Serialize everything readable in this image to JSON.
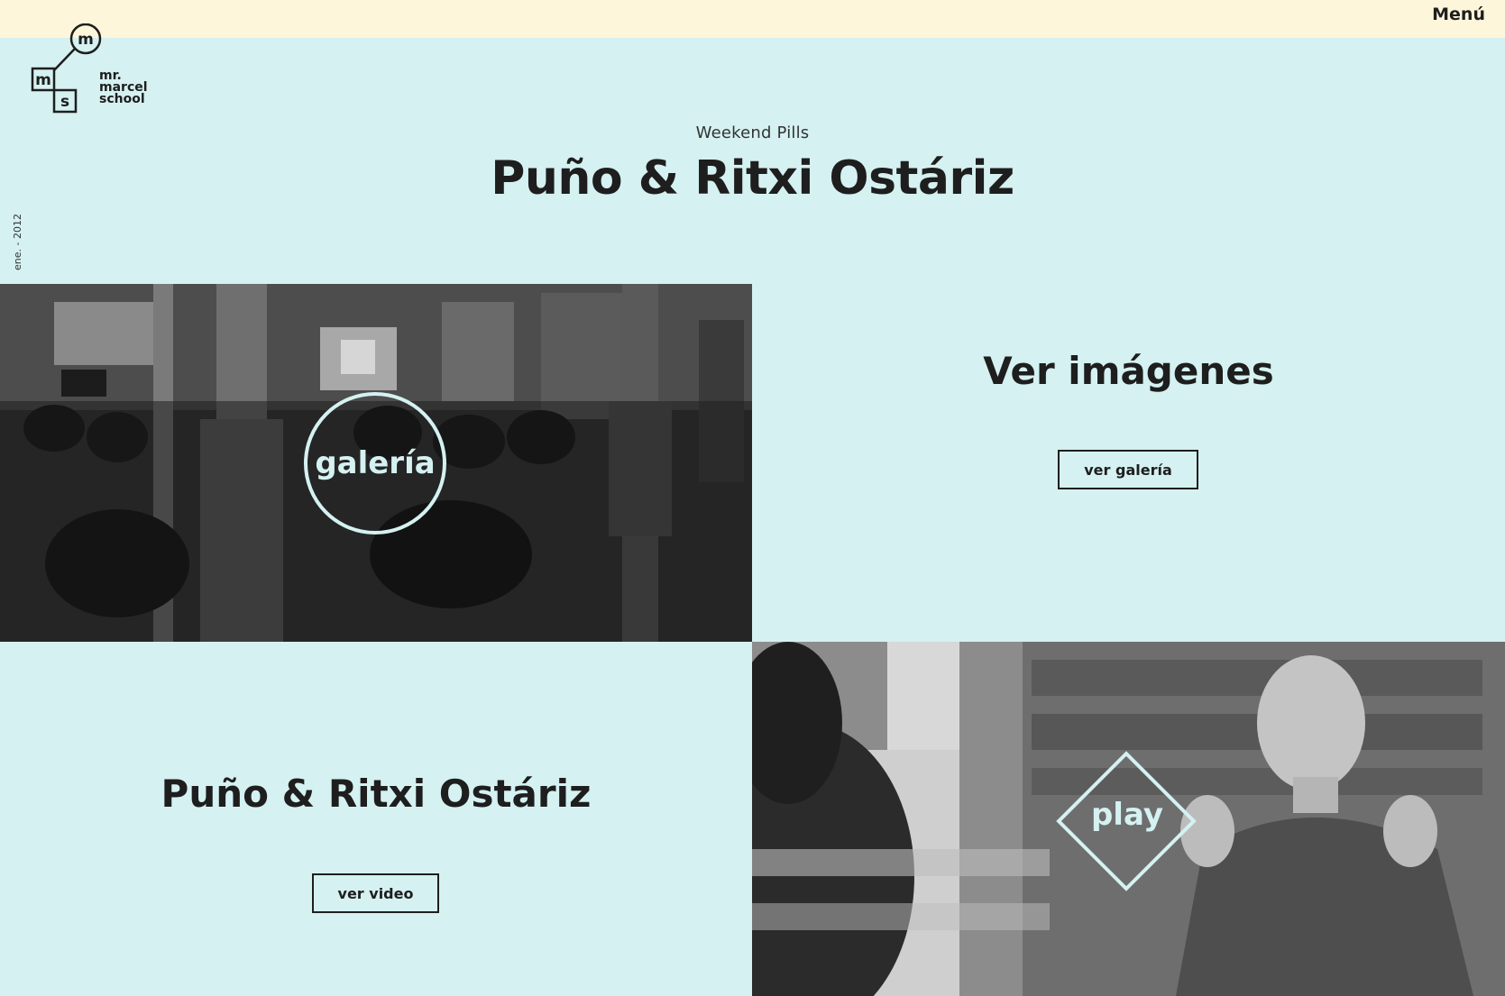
{
  "topbar": {
    "menu_label": "Menú"
  },
  "logo": {
    "letters": {
      "m_top": "m",
      "m_left": "m",
      "s": "s"
    },
    "lines": [
      "mr.",
      "marcel",
      "school"
    ]
  },
  "side_date": "ene. - 2012",
  "hero": {
    "kicker": "Weekend Pills",
    "title": "Puño & Ritxi Ostáriz"
  },
  "gallery": {
    "badge": "galería",
    "heading": "Ver imágenes",
    "button": "ver galería"
  },
  "video": {
    "badge": "play",
    "heading": "Puño & Ritxi Ostáriz",
    "button": "ver video"
  },
  "colors": {
    "background": "#d5f1f1",
    "topbar": "#fdf6da",
    "text": "#1e1e1e",
    "badge": "#d5f1f1"
  }
}
